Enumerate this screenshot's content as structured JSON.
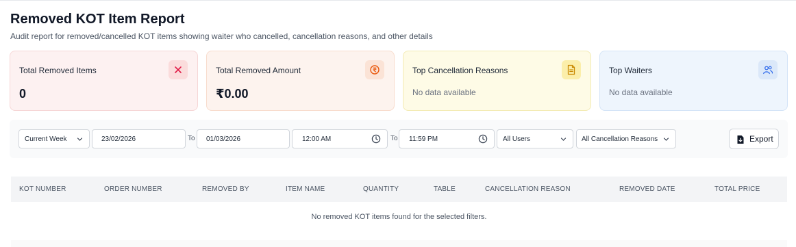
{
  "page": {
    "title": "Removed KOT Item Report",
    "subtitle": "Audit report for removed/cancelled KOT items showing waiter who cancelled, cancellation reasons, and other details"
  },
  "cards": {
    "removed_items": {
      "title": "Total Removed Items",
      "value": "0",
      "icon": "x-icon",
      "accent": "#e11d48"
    },
    "removed_amount": {
      "title": "Total Removed Amount",
      "value": "₹0.00",
      "icon": "rupee-coin-icon",
      "accent": "#ea580c"
    },
    "top_reasons": {
      "title": "Top Cancellation Reasons",
      "empty": "No data available",
      "icon": "document-icon",
      "accent": "#ca8a04"
    },
    "top_waiters": {
      "title": "Top Waiters",
      "empty": "No data available",
      "icon": "users-icon",
      "accent": "#2563eb"
    }
  },
  "filters": {
    "period": "Current Week",
    "start_date": "23/02/2026",
    "to_label": "To",
    "end_date": "01/03/2026",
    "start_time": "12:00 AM",
    "end_time": "11:59 PM",
    "user": "All Users",
    "reason": "All Cancellation Reasons",
    "export_label": "Export"
  },
  "table": {
    "columns": [
      "KOT NUMBER",
      "ORDER NUMBER",
      "REMOVED BY",
      "ITEM NAME",
      "QUANTITY",
      "TABLE",
      "CANCELLATION REASON",
      "REMOVED DATE",
      "TOTAL PRICE"
    ],
    "empty_message": "No removed KOT items found for the selected filters."
  }
}
